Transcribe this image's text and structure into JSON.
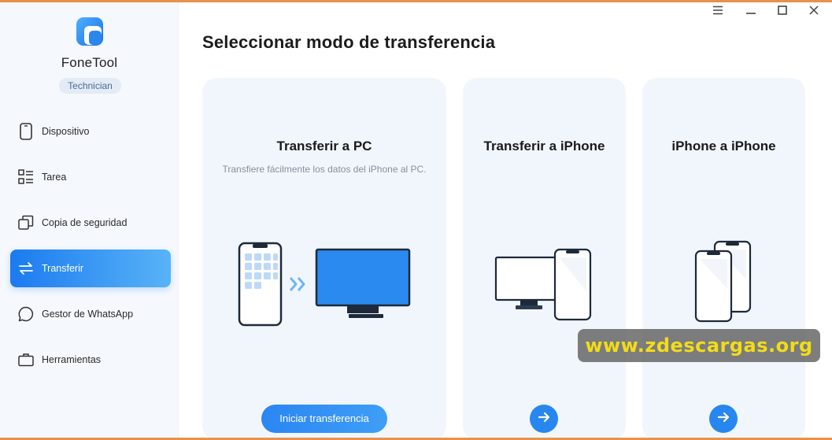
{
  "app": {
    "name": "FoneTool",
    "edition": "Technician"
  },
  "colors": {
    "accent": "#2886ef",
    "frame": "#e8914d",
    "sidebar_bg": "#f5f8fc",
    "card_bg": "#f1f6fc",
    "watermark_text": "#f2dc18"
  },
  "sidebar": {
    "items": [
      {
        "label": "Dispositivo",
        "icon": "phone-icon",
        "active": false
      },
      {
        "label": "Tarea",
        "icon": "task-list-icon",
        "active": false
      },
      {
        "label": "Copia de seguridad",
        "icon": "backup-icon",
        "active": false
      },
      {
        "label": "Transferir",
        "icon": "transfer-icon",
        "active": true
      },
      {
        "label": "Gestor de WhatsApp",
        "icon": "chat-bubble-icon",
        "active": false
      },
      {
        "label": "Herramientas",
        "icon": "toolbox-icon",
        "active": false
      }
    ]
  },
  "window_controls": [
    "menu-icon",
    "minimize-icon",
    "maximize-icon",
    "close-icon"
  ],
  "main": {
    "title": "Seleccionar modo de transferencia",
    "cards": [
      {
        "title": "Transferir a PC",
        "description": "Transfiere fácilmente los datos del iPhone al PC.",
        "button_label": "Iniciar transferencia",
        "illustration": "phone-to-pc-illustration"
      },
      {
        "title": "Transferir a iPhone",
        "button_icon": "arrow-right-icon",
        "illustration": "pc-to-phone-illustration"
      },
      {
        "title": "iPhone a iPhone",
        "button_icon": "arrow-right-icon",
        "illustration": "phone-to-phone-illustration"
      }
    ]
  },
  "watermark": {
    "text": "www.zdescargas.org"
  }
}
